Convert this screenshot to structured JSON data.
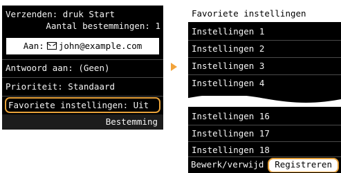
{
  "left": {
    "header_line1": "Verzenden: druk Start",
    "header_line2": "Aantal bestemmingen: 1",
    "to_label": "Aan:",
    "to_address": "john@example.com",
    "reply_to": "Antwoord aan: (Geen)",
    "priority": "Prioriteit: Standaard",
    "favorites": "Favoriete instellingen: Uit",
    "destination_button": "Bestemming"
  },
  "right": {
    "title": "Favoriete instellingen",
    "items_top": [
      "Instellingen 1",
      "Instellingen 2",
      "Instellingen 3",
      "Instellingen 4"
    ],
    "items_bottom": [
      "Instellingen 16",
      "Instellingen 17",
      "Instellingen 18"
    ],
    "edit_label": "Bewerk/verwijd",
    "register_button": "Registreren"
  },
  "colors": {
    "highlight": "#e8a23a",
    "arrow": "#f2a33a"
  },
  "icons": {
    "to_icon": "envelope-icon",
    "transition_arrow": "arrow-right-icon"
  }
}
